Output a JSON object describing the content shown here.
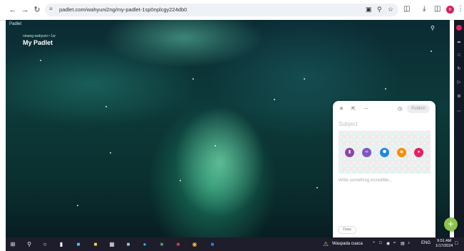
{
  "browser": {
    "url": "padlet.com/wahyuni2ng/my-padlet-1sp0nplcgy224db0",
    "back_icon": "back-arrow-icon",
    "forward_icon": "forward-arrow-icon",
    "reload_icon": "reload-icon",
    "profile_initial": "n"
  },
  "wall": {
    "brand": "Padlet",
    "breadcrumb": "ninang wahyuni • 1w",
    "title": "My Padlet"
  },
  "composer": {
    "publish_label": "Publish",
    "subject_placeholder": "Subject",
    "body_placeholder": "Write something incredible...",
    "draw_label": "Draw",
    "attachments": [
      "file-icon",
      "link-icon",
      "shape-icon",
      "camera-icon",
      "video-icon"
    ]
  },
  "fab": {
    "label": "+"
  },
  "taskbar": {
    "weather": "Waspada cuaca",
    "lang": "ENG",
    "time": "9:51 AM",
    "date": "1/17/2024"
  }
}
